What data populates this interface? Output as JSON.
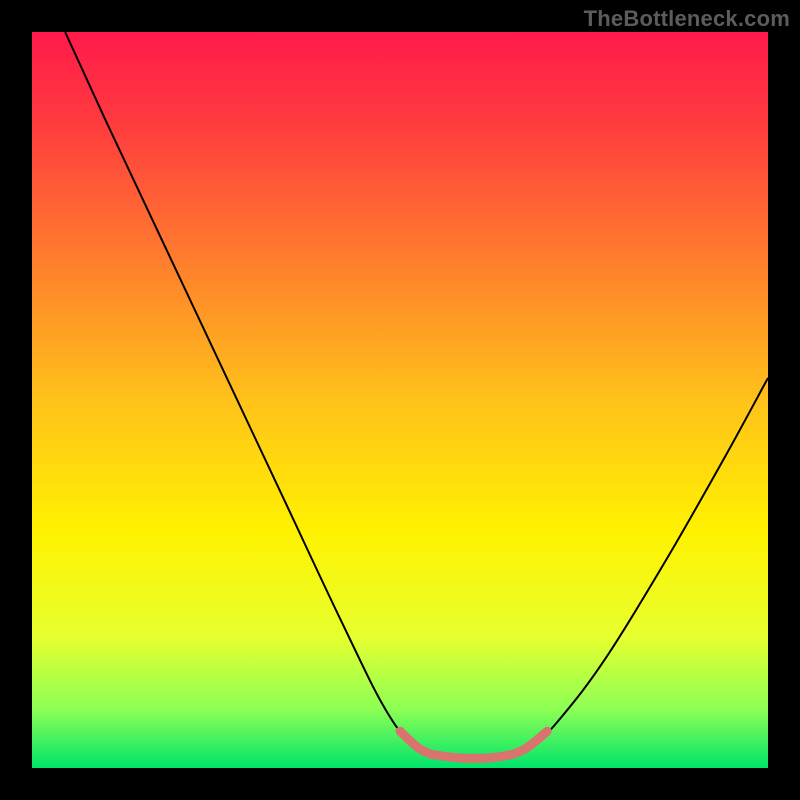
{
  "watermark": "TheBottleneck.com",
  "chart_data": {
    "type": "line",
    "title": "",
    "xlabel": "",
    "ylabel": "",
    "xlim": [
      0,
      100
    ],
    "ylim": [
      0,
      100
    ],
    "grid": false,
    "legend": false,
    "background_gradient_stops": [
      {
        "offset": 0.0,
        "color": "#ff1a4b"
      },
      {
        "offset": 0.12,
        "color": "#ff3a3f"
      },
      {
        "offset": 0.3,
        "color": "#ff7a2e"
      },
      {
        "offset": 0.5,
        "color": "#ffc21a"
      },
      {
        "offset": 0.68,
        "color": "#fff200"
      },
      {
        "offset": 0.82,
        "color": "#e7ff2e"
      },
      {
        "offset": 0.92,
        "color": "#8dff55"
      },
      {
        "offset": 1.0,
        "color": "#00e46a"
      }
    ],
    "series": [
      {
        "name": "bottleneck-curve",
        "stroke": "#000000",
        "stroke_width": 2,
        "points": [
          {
            "x": 4.5,
            "y": 100.0
          },
          {
            "x": 10.0,
            "y": 88.0
          },
          {
            "x": 18.0,
            "y": 71.0
          },
          {
            "x": 26.0,
            "y": 54.0
          },
          {
            "x": 34.0,
            "y": 37.0
          },
          {
            "x": 42.0,
            "y": 20.0
          },
          {
            "x": 48.0,
            "y": 8.0
          },
          {
            "x": 52.0,
            "y": 3.0
          },
          {
            "x": 56.0,
            "y": 1.5
          },
          {
            "x": 60.0,
            "y": 1.2
          },
          {
            "x": 64.0,
            "y": 1.5
          },
          {
            "x": 68.0,
            "y": 3.0
          },
          {
            "x": 72.0,
            "y": 7.0
          },
          {
            "x": 78.0,
            "y": 15.0
          },
          {
            "x": 86.0,
            "y": 28.0
          },
          {
            "x": 94.0,
            "y": 42.0
          },
          {
            "x": 100.0,
            "y": 53.0
          }
        ]
      },
      {
        "name": "optimal-band-marker",
        "stroke": "#d8736e",
        "stroke_width": 9,
        "stroke_linecap": "round",
        "points": [
          {
            "x": 50.0,
            "y": 5.0
          },
          {
            "x": 53.0,
            "y": 2.4
          },
          {
            "x": 56.0,
            "y": 1.6
          },
          {
            "x": 60.0,
            "y": 1.3
          },
          {
            "x": 64.0,
            "y": 1.6
          },
          {
            "x": 67.0,
            "y": 2.6
          },
          {
            "x": 70.0,
            "y": 5.0
          }
        ]
      }
    ]
  }
}
